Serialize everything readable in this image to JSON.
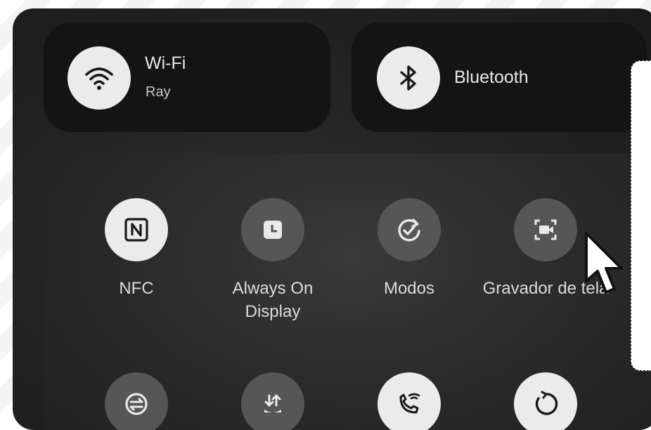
{
  "wifi": {
    "title": "Wi-Fi",
    "network": "Ray",
    "icon": "wifi-icon"
  },
  "bluetooth": {
    "title": "Bluetooth",
    "icon": "bluetooth-icon"
  },
  "quick_settings": [
    {
      "label": "NFC",
      "icon": "nfc-icon",
      "active": true
    },
    {
      "label": "Always On Display",
      "icon": "clock-icon",
      "active": false
    },
    {
      "label": "Modos",
      "icon": "modes-icon",
      "active": false
    },
    {
      "label": "Gravador de tela",
      "icon": "screen-record-icon",
      "active": false
    },
    {
      "label": "",
      "icon": "data-saver-icon",
      "active": false
    },
    {
      "label": "",
      "icon": "data-transfer-icon",
      "active": false
    },
    {
      "label": "",
      "icon": "wifi-calling-icon",
      "active": true
    },
    {
      "label": "",
      "icon": "auto-rotate-icon",
      "active": true
    }
  ],
  "colors": {
    "active_bg": "#ebebeb",
    "inactive_bg": "#565656",
    "panel_bg": "#222222"
  }
}
